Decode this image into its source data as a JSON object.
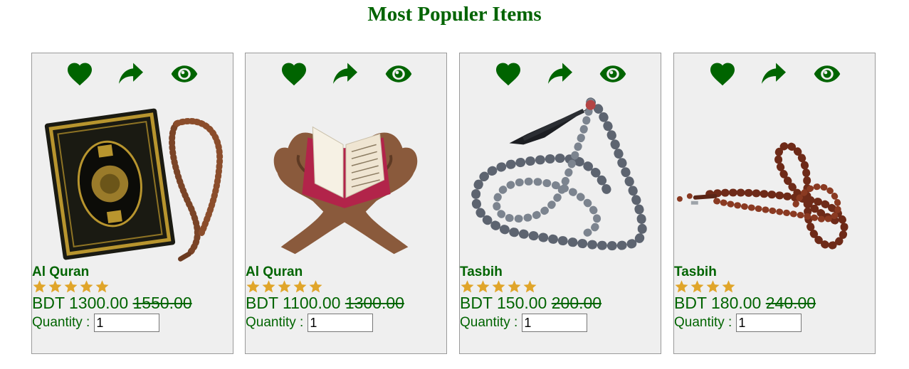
{
  "page": {
    "title": "Most Populer Items"
  },
  "colors": {
    "primary": "#006400",
    "star": "#e0a52a",
    "card_bg": "#efefef"
  },
  "card_icons": [
    "heart-icon",
    "share-icon",
    "eye-icon"
  ],
  "products": [
    {
      "name": "Al Quran",
      "currency": "BDT",
      "price": "1300.00",
      "old_price": "1550.00",
      "rating": 5,
      "quantity_label": "Quantity :",
      "quantity": "1",
      "image": "quran-with-prayer-beads"
    },
    {
      "name": "Al Quran",
      "currency": "BDT",
      "price": "1100.00",
      "old_price": "1300.00",
      "rating": 5,
      "quantity_label": "Quantity :",
      "quantity": "1",
      "image": "quran-on-wooden-stand"
    },
    {
      "name": "Tasbih",
      "currency": "BDT",
      "price": "150.00",
      "old_price": "200.00",
      "rating": 5,
      "quantity_label": "Quantity :",
      "quantity": "1",
      "image": "grey-hematite-tasbih"
    },
    {
      "name": "Tasbih",
      "currency": "BDT",
      "price": "180.00",
      "old_price": "240.00",
      "rating": 4,
      "quantity_label": "Quantity :",
      "quantity": "1",
      "image": "brown-wooden-tasbih"
    }
  ]
}
